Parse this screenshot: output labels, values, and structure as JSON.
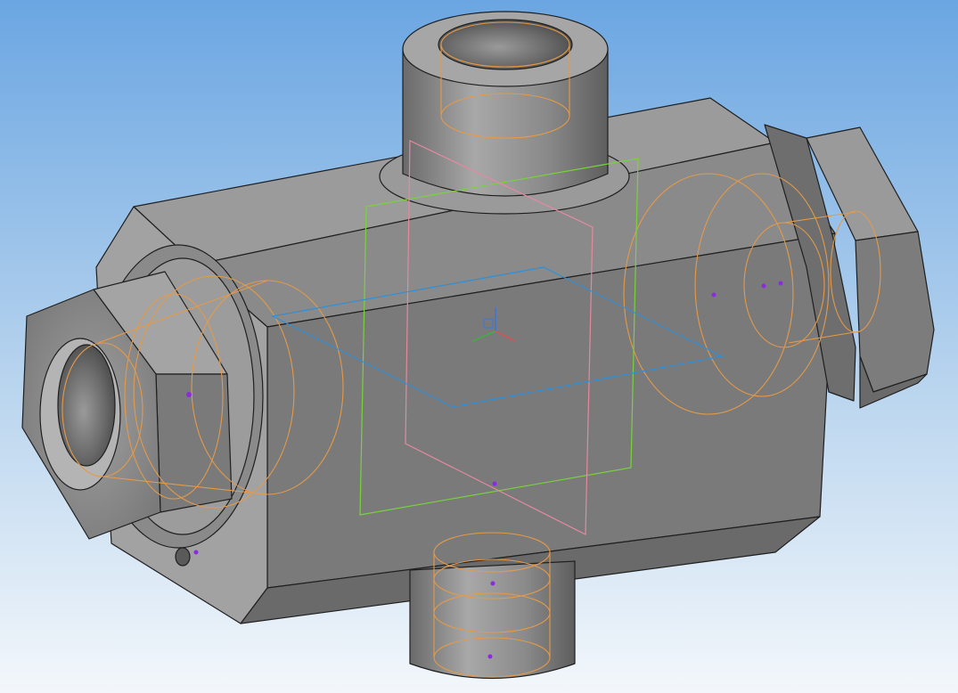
{
  "viewport": {
    "background_top": "#6ba6e2",
    "background_bottom": "#f3f7fb"
  },
  "model": {
    "shaded_color": "#8d8d8d",
    "edge_color": "#1f1f1f"
  },
  "overlay_colors": {
    "hidden_edges": "#e39a4a",
    "plane_xy": "#2f8fd8",
    "plane_xz": "#78d23c",
    "plane_yz": "#e48aa0",
    "point_marker": "#8a2be2"
  },
  "origin_triad": {
    "x_color": "#e05050",
    "y_color": "#40b040",
    "z_color": "#3a78d8"
  }
}
